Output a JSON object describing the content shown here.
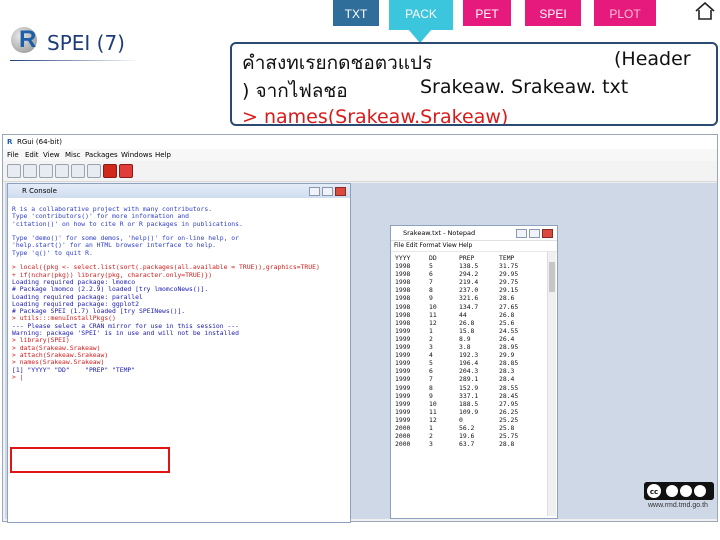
{
  "nav": {
    "tabs": [
      {
        "label": "TXT"
      },
      {
        "label": "PACK"
      },
      {
        "label": "PET"
      },
      {
        "label": "SPEI"
      },
      {
        "label": "PLOT"
      }
    ],
    "home_icon": "home-icon"
  },
  "logo": {
    "letter": "R",
    "title": "SPEI (7)"
  },
  "header": {
    "line1_thai": "คำสงทเรยกดชอตวแปร",
    "line1_en": "(Header",
    "line2_thai": ") จากไฟลชอ",
    "line2_en": "Srakeaw. Srakeaw. txt",
    "line3_cmd": "> names(Srakeaw.Srakeaw)"
  },
  "rgui": {
    "title": "RGui (64-bit)",
    "menu": [
      "File",
      "Edit",
      "View",
      "Misc",
      "Packages",
      "Windows",
      "Help"
    ],
    "console": {
      "title": "R Console",
      "lines": [
        {
          "text": "R is a collaborative project with many contributors.",
          "type": "info"
        },
        {
          "text": "Type 'contributors()' for more information and",
          "type": "info"
        },
        {
          "text": "'citation()' on how to cite R or R packages in publications.",
          "type": "info"
        },
        {
          "text": "",
          "type": "info"
        },
        {
          "text": "Type 'demo()' for some demos, 'help()' for on-line help, or",
          "type": "info"
        },
        {
          "text": "'help.start()' for an HTML browser interface to help.",
          "type": "info"
        },
        {
          "text": "Type 'q()' to quit R.",
          "type": "info"
        },
        {
          "text": "",
          "type": "info"
        },
        {
          "text": "> local({pkg <- select.list(sort(.packages(all.available = TRUE)),graphics=TRUE)",
          "type": "cmd"
        },
        {
          "text": "+ if(nchar(pkg)) library(pkg, character.only=TRUE)})",
          "type": "cmd"
        },
        {
          "text": "Loading required package: lmomco",
          "type": "out"
        },
        {
          "text": "# Package lmomco (2.2.9) loaded [try lmomcoNews()].",
          "type": "out"
        },
        {
          "text": "Loading required package: parallel",
          "type": "out"
        },
        {
          "text": "Loading required package: ggplot2",
          "type": "out"
        },
        {
          "text": "# Package SPEI (1.7) loaded [try SPEINews()].",
          "type": "out"
        },
        {
          "text": "> utils:::menuInstallPkgs()",
          "type": "cmd"
        },
        {
          "text": "--- Please select a CRAN mirror for use in this session ---",
          "type": "out"
        },
        {
          "text": "Warning: package 'SPEI' is in use and will not be installed",
          "type": "out"
        },
        {
          "text": "> library(SPEI)",
          "type": "cmd"
        },
        {
          "text": "> data(Srakeaw.Srakeaw)",
          "type": "cmd"
        },
        {
          "text": "> attach(Srakeaw.Srakeaw)",
          "type": "cmd"
        },
        {
          "text": "> names(Srakeaw.Srakeaw)",
          "type": "cmd"
        },
        {
          "text": "[1] \"YYYY\" \"DD\"    \"PREP\" \"TEMP\"",
          "type": "out"
        },
        {
          "text": "> |",
          "type": "cmd"
        }
      ]
    },
    "notepad": {
      "title": "Srakeaw.txt - Notepad",
      "menu": "File  Edit  Format  View  Help",
      "header": [
        "YYYY",
        "DD",
        "PREP",
        "TEMP"
      ],
      "rows": [
        [
          "1998",
          "5",
          "138.5",
          "31.75"
        ],
        [
          "1998",
          "6",
          "294.2",
          "29.95"
        ],
        [
          "1998",
          "7",
          "219.4",
          "29.75"
        ],
        [
          "1998",
          "8",
          "237.0",
          "29.15"
        ],
        [
          "1998",
          "9",
          "321.6",
          "28.6"
        ],
        [
          "1998",
          "10",
          "134.7",
          "27.65"
        ],
        [
          "1998",
          "11",
          "44",
          "26.8"
        ],
        [
          "1998",
          "12",
          "26.8",
          "25.6"
        ],
        [
          "1999",
          "1",
          "15.8",
          "24.55"
        ],
        [
          "1999",
          "2",
          "8.9",
          "26.4"
        ],
        [
          "1999",
          "3",
          "3.8",
          "28.95"
        ],
        [
          "1999",
          "4",
          "192.3",
          "29.9"
        ],
        [
          "1999",
          "5",
          "196.4",
          "28.85"
        ],
        [
          "1999",
          "6",
          "204.3",
          "28.3"
        ],
        [
          "1999",
          "7",
          "289.1",
          "28.4"
        ],
        [
          "1999",
          "8",
          "152.9",
          "28.55"
        ],
        [
          "1999",
          "9",
          "337.1",
          "28.45"
        ],
        [
          "1999",
          "10",
          "188.5",
          "27.95"
        ],
        [
          "1999",
          "11",
          "109.9",
          "26.25"
        ],
        [
          "1999",
          "12",
          "0",
          "25.25"
        ],
        [
          "2000",
          "1",
          "56.2",
          "25.8"
        ],
        [
          "2000",
          "2",
          "19.6",
          "25.75"
        ],
        [
          "2000",
          "3",
          "63.7",
          "28.8"
        ]
      ]
    }
  },
  "footer": {
    "url": "www.rmd.tmd.go.th",
    "badge_icon": "creative-commons-icon"
  },
  "colors": {
    "pink_tab": "#e6197d",
    "cyan_tab": "#3bc6dd",
    "blue_tab": "#2f6e9a",
    "highlight": "#e01414"
  }
}
